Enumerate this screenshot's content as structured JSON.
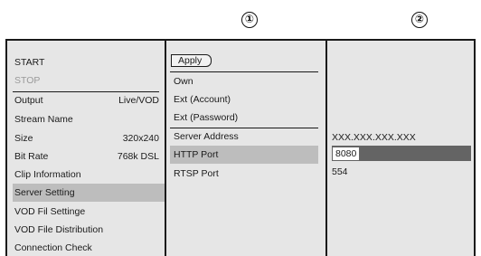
{
  "callouts": [
    "①",
    "②"
  ],
  "menu": {
    "items": [
      {
        "label": "START",
        "value": ""
      },
      {
        "label": "STOP",
        "value": ""
      },
      {
        "label": "Output",
        "value": "Live/VOD"
      },
      {
        "label": "Stream Name",
        "value": ""
      },
      {
        "label": "Size",
        "value": "320x240"
      },
      {
        "label": "Bit Rate",
        "value": "768k DSL"
      },
      {
        "label": "Clip Information",
        "value": ""
      },
      {
        "label": "Server Setting",
        "value": ""
      },
      {
        "label": "VOD Fil Settinge",
        "value": ""
      },
      {
        "label": "VOD File Distribution",
        "value": ""
      },
      {
        "label": "Connection Check",
        "value": ""
      }
    ],
    "selected": "Server Setting",
    "disabled": "STOP"
  },
  "submenu": {
    "apply_label": "Apply",
    "items": [
      "Own",
      "Ext (Account)",
      "Ext (Password)",
      "Server Address",
      "HTTP Port",
      "RTSP Port"
    ],
    "selected": "HTTP Port"
  },
  "values": {
    "server_address": "XXX.XXX.XXX.XXX",
    "http_port": "8080",
    "rtsp_port": "554"
  }
}
